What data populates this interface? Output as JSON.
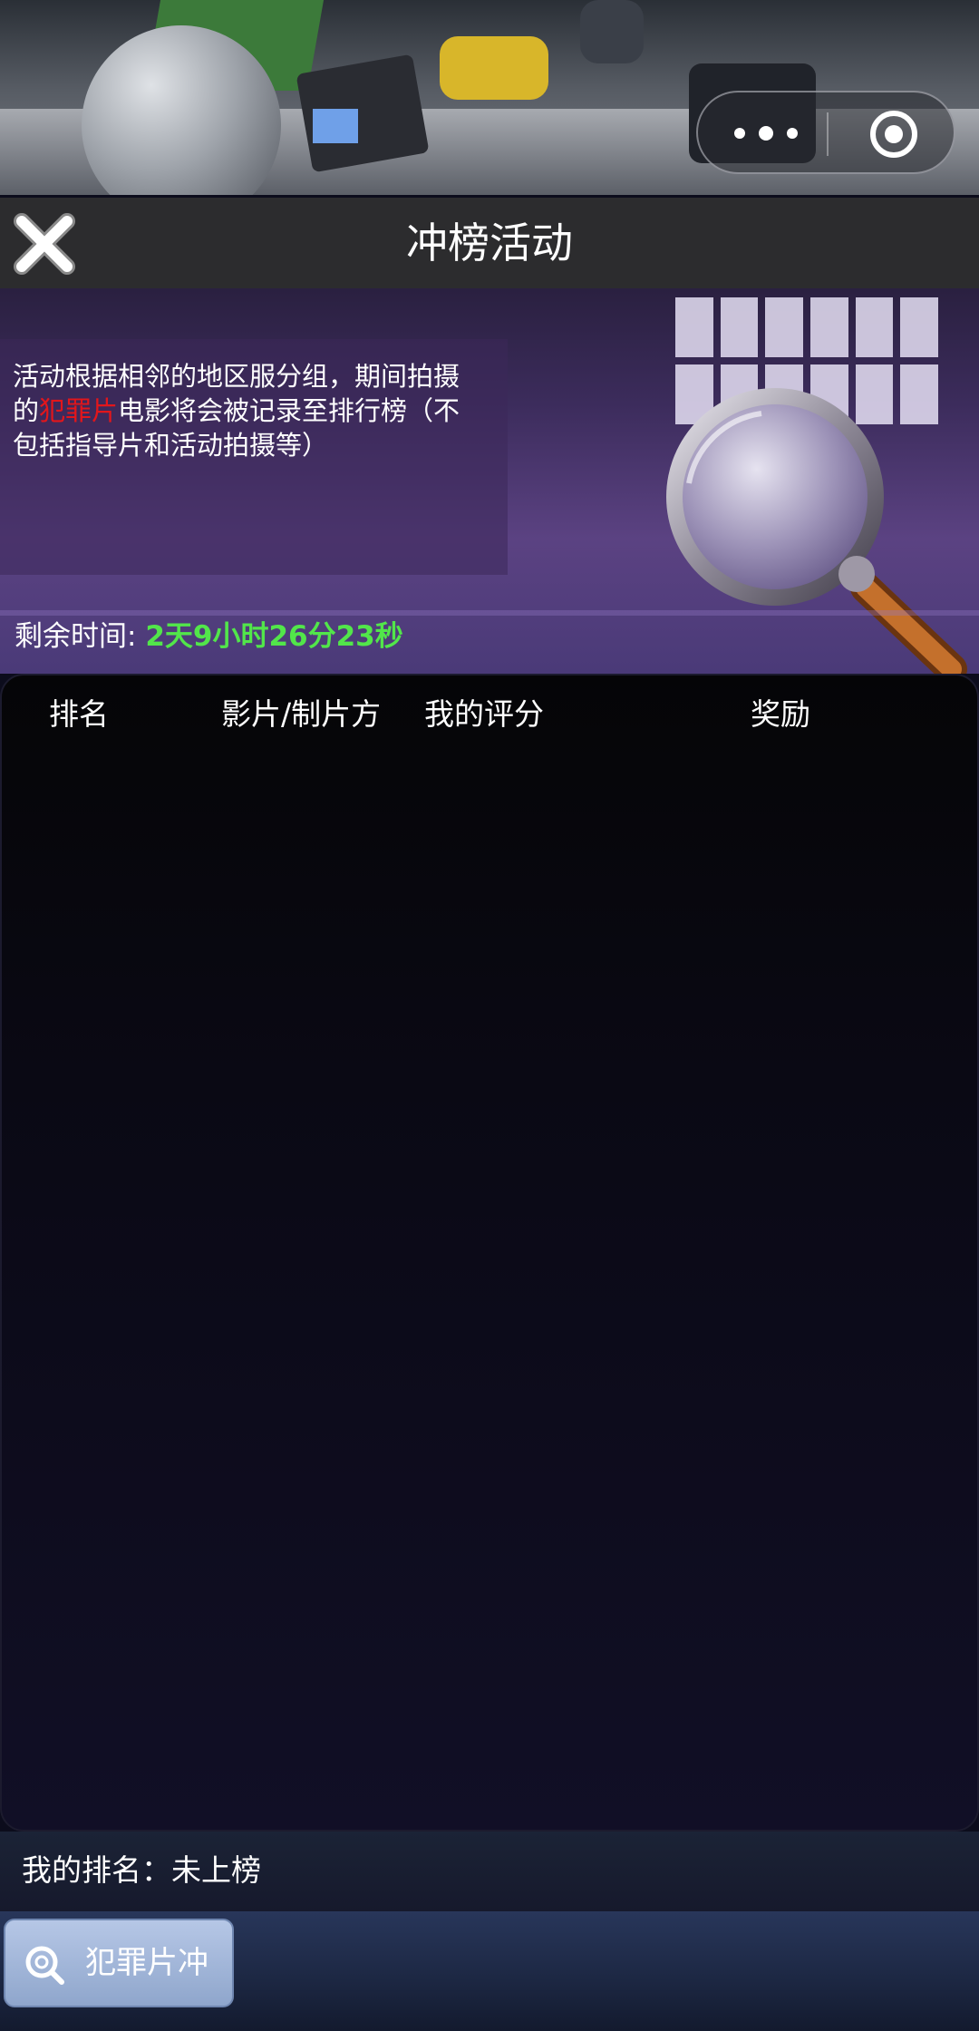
{
  "header": {
    "title": "冲榜活动",
    "close_icon": "close-x-icon"
  },
  "capsule": {
    "more_icon": "more-dots-icon",
    "exit_icon": "target-circle-icon"
  },
  "banner": {
    "desc_before": "活动根据相邻的地区服分组，期间拍摄的",
    "desc_highlight": "犯罪片",
    "desc_after": "电影将会被记录至排行榜（不包括指导片和活动拍摄等）",
    "timer_label": "剩余时间:",
    "timer_value": "2天9小时26分23秒",
    "highlight_color": "#e2161b",
    "timer_color": "#52e64a"
  },
  "board": {
    "columns": [
      "排名",
      "影片/制片方",
      "我的评分",
      "奖励"
    ],
    "rows": []
  },
  "my_rank": {
    "label": "我的排名：",
    "value": "未上榜"
  },
  "tabs": [
    {
      "label": "犯罪片冲",
      "icon": "magnifier-icon",
      "active": true
    }
  ]
}
